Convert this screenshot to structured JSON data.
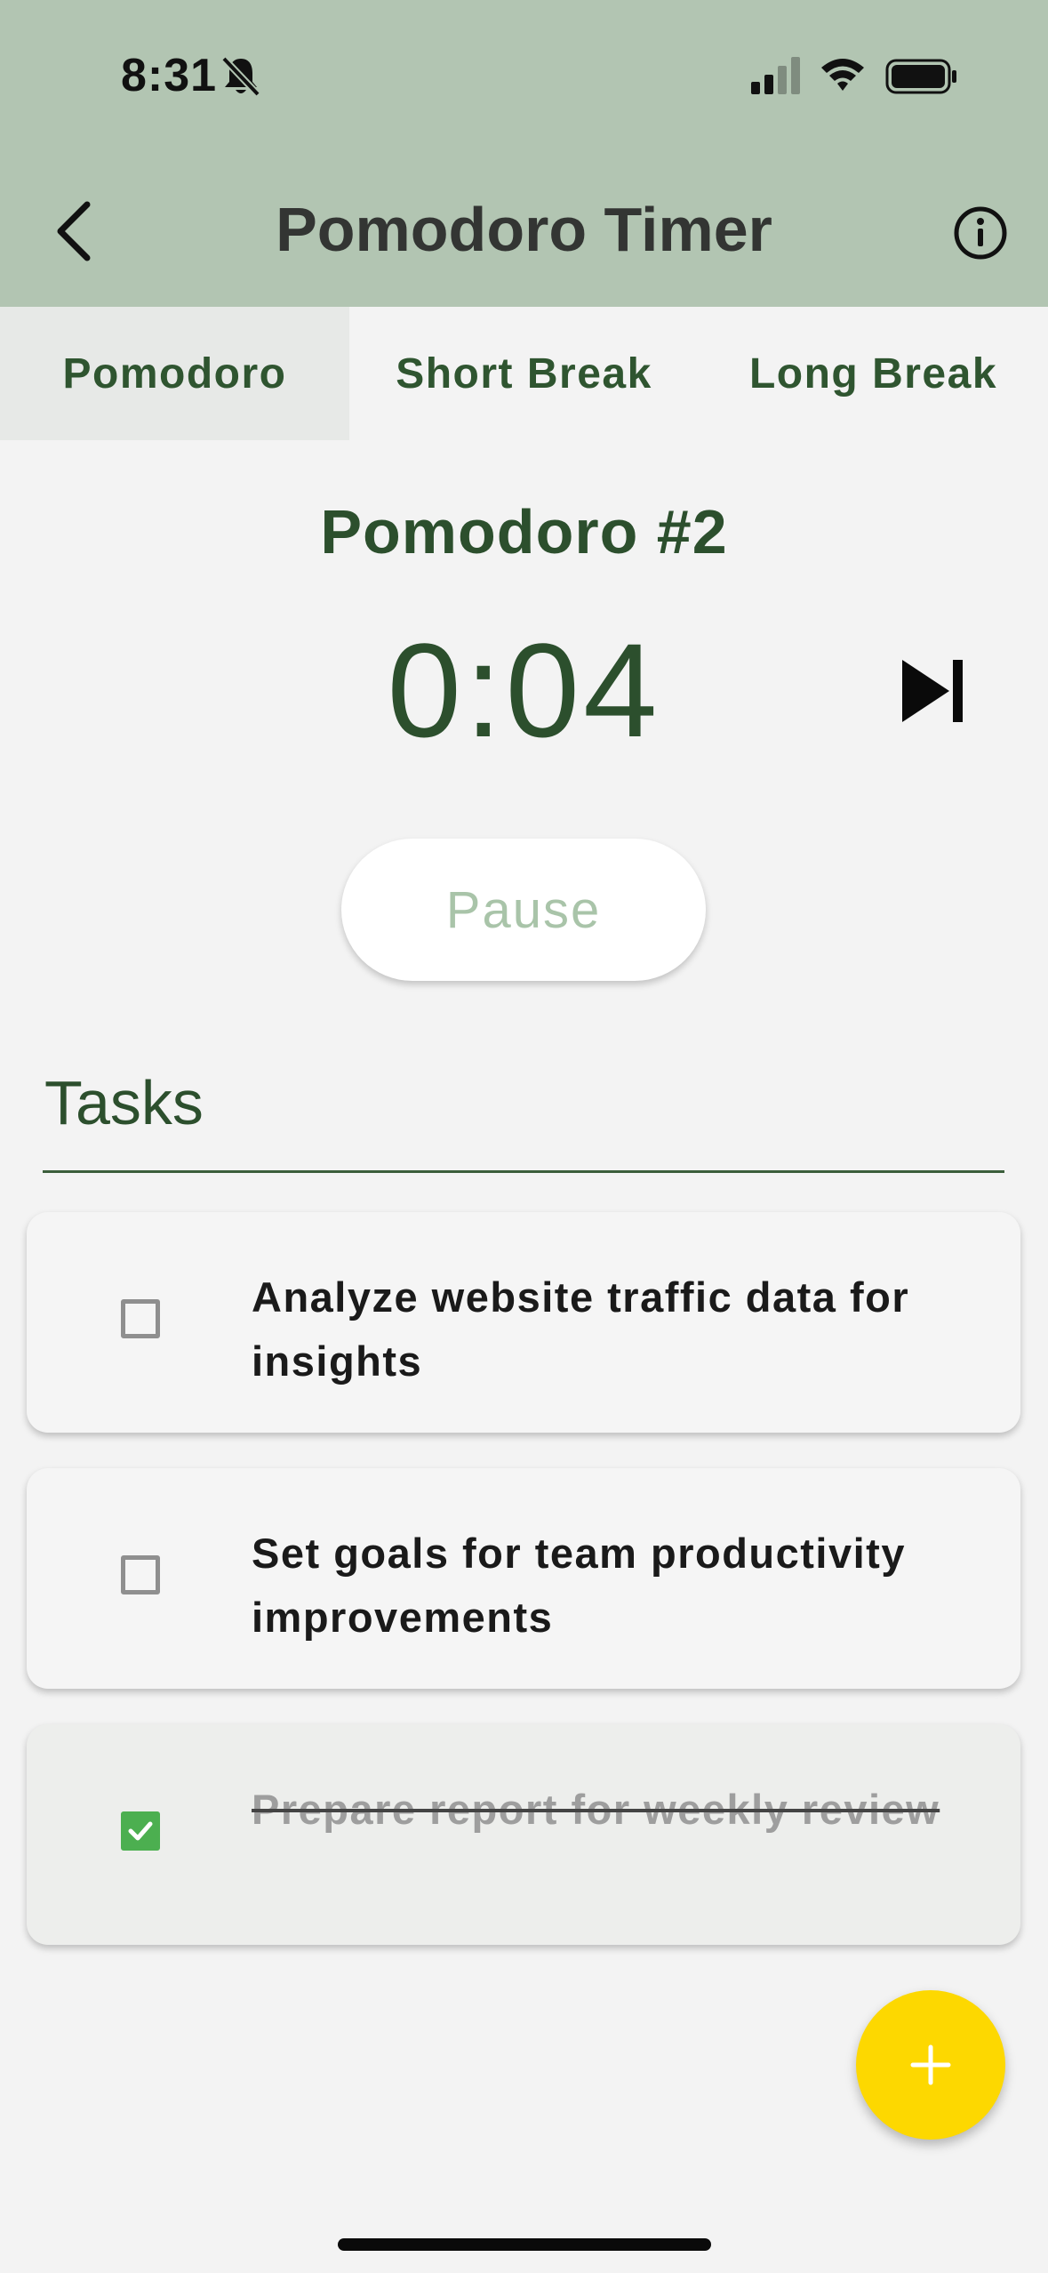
{
  "status_bar": {
    "time": "8:31"
  },
  "header": {
    "title": "Pomodoro Timer"
  },
  "tabs": [
    {
      "label": "Pomodoro",
      "active": true
    },
    {
      "label": "Short Break",
      "active": false
    },
    {
      "label": "Long Break",
      "active": false
    }
  ],
  "timer": {
    "session_title": "Pomodoro #2",
    "time": "0:04",
    "pause_label": "Pause"
  },
  "tasks": {
    "heading": "Tasks",
    "items": [
      {
        "text": "Analyze website traffic data for insights",
        "done": false
      },
      {
        "text": "Set goals for team productivity improvements",
        "done": false
      },
      {
        "text": "Prepare report for weekly review",
        "done": true
      }
    ]
  },
  "colors": {
    "header_bg": "#b2c5b2",
    "primary_green": "#2c4f2d",
    "fab_yellow": "#fdd800",
    "check_green": "#4caf50"
  },
  "icons": [
    "bell-slash-icon",
    "signal-icon",
    "wifi-icon",
    "battery-icon",
    "chevron-left-icon",
    "info-icon",
    "skip-next-icon",
    "check-icon",
    "plus-icon"
  ]
}
